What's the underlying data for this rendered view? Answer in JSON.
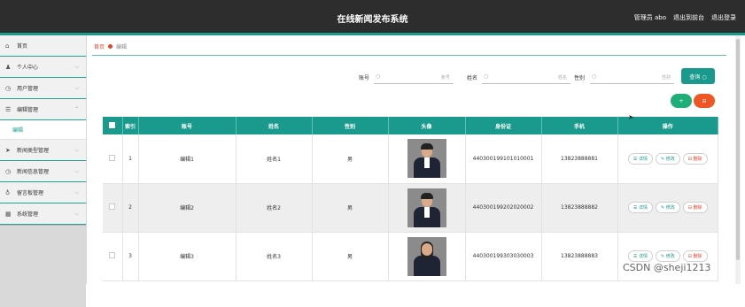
{
  "header": {
    "title": "在线新闻发布系统",
    "user": "管理员 abo",
    "back_to_front": "退出到前台",
    "logout": "退出登录"
  },
  "sidebar": {
    "items": [
      {
        "label": "首页",
        "icon": "home-icon",
        "glyph": "⌂"
      },
      {
        "label": "个人中心",
        "icon": "user-icon",
        "glyph": "♟"
      },
      {
        "label": "用户管理",
        "icon": "clock-icon",
        "glyph": "◷"
      },
      {
        "label": "编辑管理",
        "icon": "list-icon",
        "glyph": "☰"
      },
      {
        "label": "编辑",
        "icon": "",
        "glyph": ""
      },
      {
        "label": "新闻类型管理",
        "icon": "send-icon",
        "glyph": "➤"
      },
      {
        "label": "新闻信息管理",
        "icon": "clock-icon",
        "glyph": "◷"
      },
      {
        "label": "留言板管理",
        "icon": "mic-icon",
        "glyph": "♁"
      },
      {
        "label": "系统管理",
        "icon": "grid-icon",
        "glyph": "▦"
      }
    ]
  },
  "breadcrumb": {
    "home": "首页",
    "current": "编辑"
  },
  "search": {
    "account_label": "账号",
    "account_placeholder": "账号",
    "name_label": "姓名",
    "name_placeholder": "姓名",
    "gender_label": "性别",
    "gender_placeholder": "性别",
    "query_button": "查询 ○"
  },
  "actions": {
    "add": "+",
    "delete": "⊟"
  },
  "table": {
    "columns": [
      "索引",
      "账号",
      "姓名",
      "性别",
      "头像",
      "身份证",
      "手机",
      "操作"
    ],
    "rows": [
      {
        "index": "1",
        "account": "编辑1",
        "name": "姓名1",
        "gender": "男",
        "idcard": "440300199101010001",
        "phone": "13823888881",
        "avatar": "male"
      },
      {
        "index": "2",
        "account": "编辑2",
        "name": "姓名2",
        "gender": "男",
        "idcard": "440300199202020002",
        "phone": "13823888882",
        "avatar": "male"
      },
      {
        "index": "3",
        "account": "编辑3",
        "name": "姓名3",
        "gender": "男",
        "idcard": "440300199303030003",
        "phone": "13823888883",
        "avatar": "female"
      }
    ],
    "op_detail": "☰ 详情",
    "op_edit": "✎ 修改",
    "op_delete": "⊟ 删除"
  },
  "watermark": "CSDN @sheji1213",
  "colors": {
    "accent": "#1a9a8c",
    "danger": "#f05524",
    "add": "#1fae77",
    "topbar": "#2d2d2d"
  }
}
